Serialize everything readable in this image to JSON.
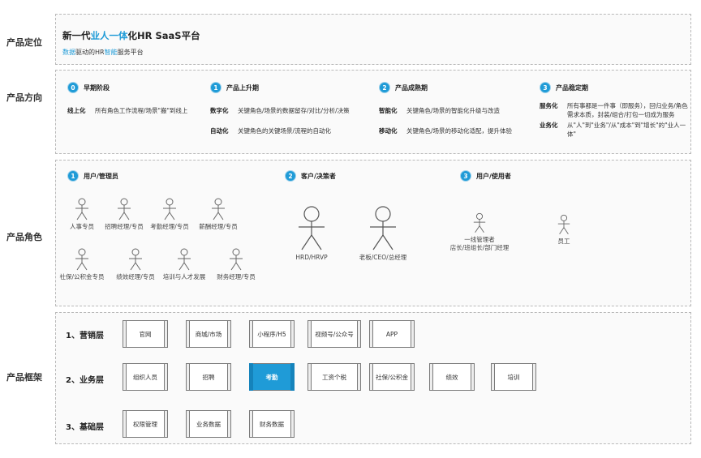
{
  "sections": {
    "positioning_label": "产品定位",
    "direction_label": "产品方向",
    "roles_label": "产品角色",
    "framework_label": "产品框架"
  },
  "positioning": {
    "title_parts": [
      "新一代",
      "业人一体",
      "化HR SaaS平台"
    ],
    "subtitle_parts": [
      "数据",
      "驱动的HR",
      "智能",
      "服务平台"
    ]
  },
  "direction": {
    "stages": [
      {
        "num": "0",
        "name": "早期阶段",
        "items": [
          {
            "key": "线上化",
            "value": "所有角色工作流程/场景\"搬\"到线上"
          }
        ]
      },
      {
        "num": "1",
        "name": "产品上升期",
        "items": [
          {
            "key": "数字化",
            "value": "关键角色/场景的数据留存/对比/分析/决策"
          },
          {
            "key": "自动化",
            "value": "关键角色的关键场景/流程的自动化"
          }
        ]
      },
      {
        "num": "2",
        "name": "产品成熟期",
        "items": [
          {
            "key": "智能化",
            "value": "关键角色/场景的智能化升级与改造"
          },
          {
            "key": "移动化",
            "value": "关键角色/场景的移动化适配，提升体验"
          }
        ]
      },
      {
        "num": "3",
        "name": "产品稳定期",
        "items": [
          {
            "key": "服务化",
            "value": "所有事都是一件事（即服务），回归业务/角色需求本质，封装/组合/打包一切成为服务"
          },
          {
            "key": "业务化",
            "value": "从\"人\"到\"业务\"/从\"成本\"到\"增长\"的\"业人一体\""
          }
        ]
      }
    ]
  },
  "roles": {
    "groups": [
      {
        "num": "1",
        "name": "用户/管理员"
      },
      {
        "num": "2",
        "name": "客户/决策者"
      },
      {
        "num": "3",
        "name": "用户/使用者"
      }
    ],
    "admins_row1": [
      "人事专员",
      "招聘经理/专员",
      "考勤经理/专员",
      "薪酬经理/专员"
    ],
    "admins_row2": [
      "社保/公积金专员",
      "绩效经理/专员",
      "培训与人才发展",
      "财务经理/专员"
    ],
    "deciders": [
      "HRD/HRVP",
      "老板/CEO/总经理"
    ],
    "users": [
      "一线管理者\n店长/班组长/部门经理",
      "员工"
    ]
  },
  "framework": {
    "layers": [
      {
        "name": "1、营销层",
        "modules": [
          "官网",
          "商城/市场",
          "小程序/H5",
          "视频号/公众号",
          "APP"
        ]
      },
      {
        "name": "2、业务层",
        "modules": [
          "组织人员",
          "招聘",
          "考勤",
          "工资个税",
          "社保/公积金",
          "绩效",
          "培训"
        ]
      },
      {
        "name": "3、基础层",
        "modules": [
          "权限管理",
          "业务数据",
          "财务数据"
        ]
      }
    ],
    "highlighted_module": "考勤",
    "accent_color": "#1f9bd7"
  }
}
